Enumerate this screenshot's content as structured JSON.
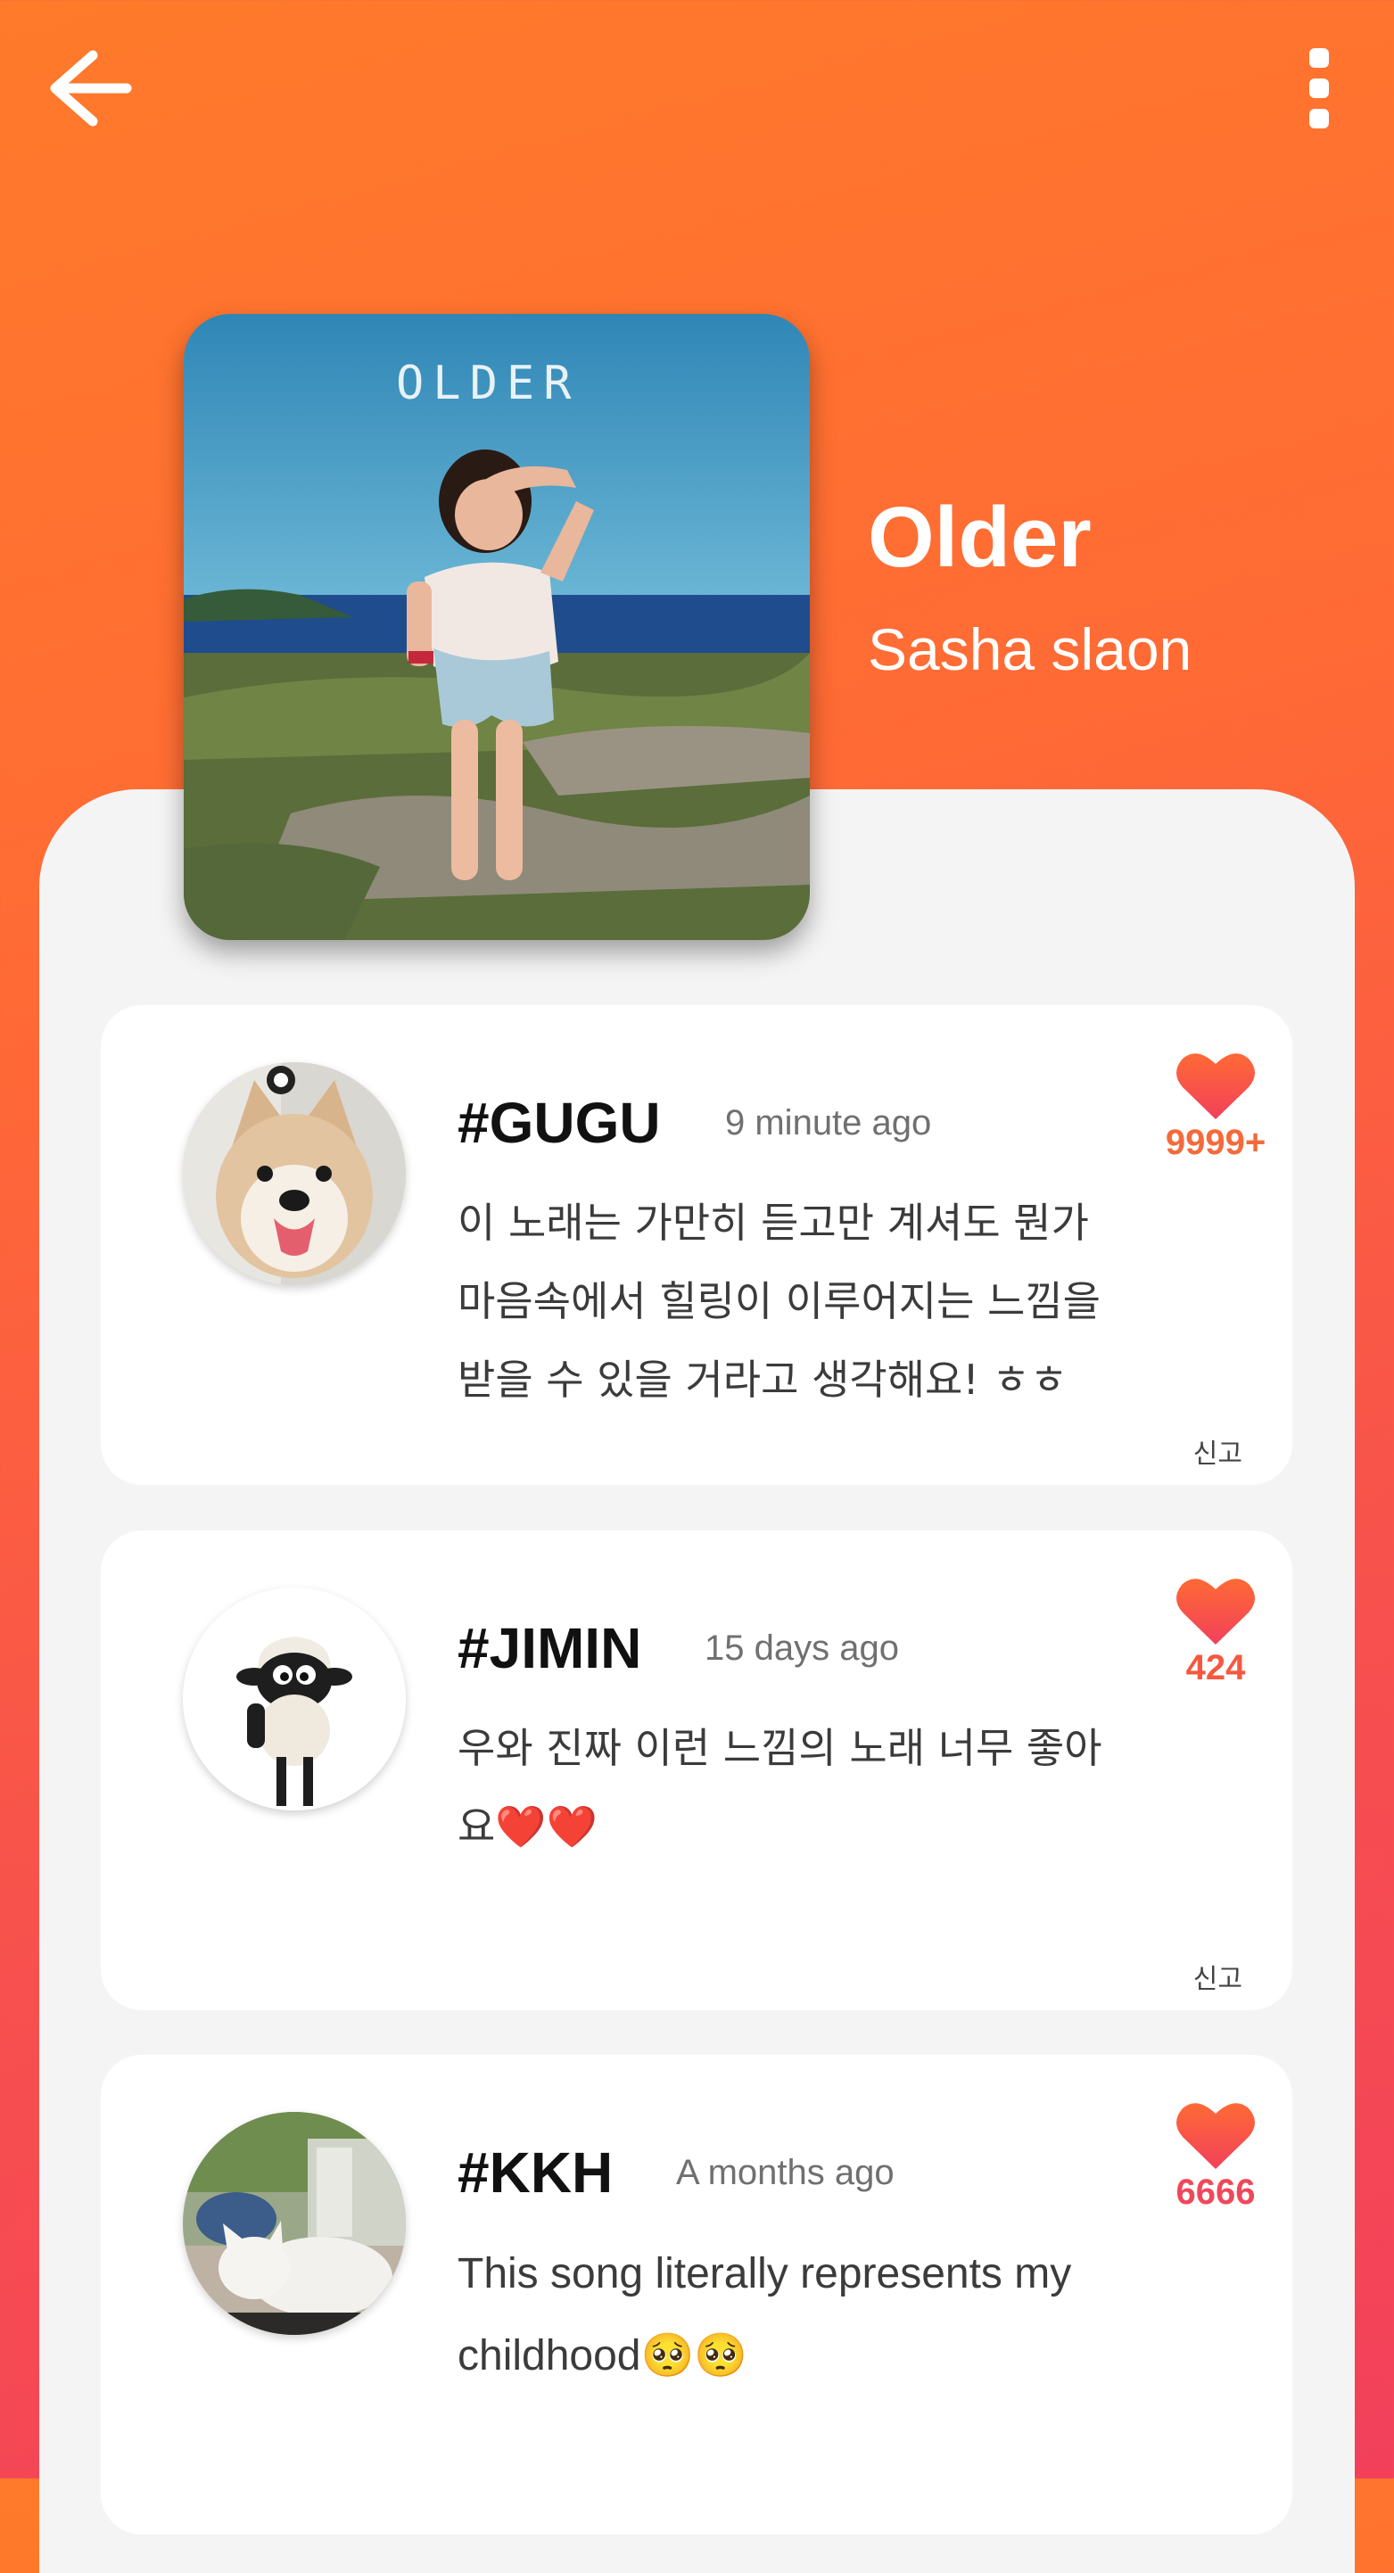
{
  "header": {
    "back_icon": "arrow-left-icon",
    "menu_icon": "more-vertical-icon"
  },
  "song": {
    "cover_text": "OLDER",
    "title": "Older",
    "artist": "Sasha slaon"
  },
  "comments": [
    {
      "username": "#GUGU",
      "time": "9 minute ago",
      "text": "이 노래는 가만히 듣고만 계셔도 뭔가 마음속에서 힐링이 이루어지는 느낌을 받을 수 있을 거라고 생각해요! ㅎㅎ",
      "likes": "9999+",
      "like_color": "#f46a3a",
      "report_label": "신고",
      "avatar": "dog"
    },
    {
      "username": "#JIMIN",
      "time": "15 days ago",
      "text": "우와 진짜 이런 느낌의 노래 너무 좋아요❤️❤️",
      "likes": "424",
      "like_color": "#f4593f",
      "report_label": "신고",
      "avatar": "sheep"
    },
    {
      "username": "#KKH",
      "time": "A months ago",
      "text": "This song literally represents my childhood🥺🥺",
      "likes": "6666",
      "like_color": "#f0485a",
      "report_label": "",
      "avatar": "cat"
    }
  ],
  "colors": {
    "gradient_top": "#ff7a2a",
    "gradient_bottom": "#f2405b",
    "heart_top": "#ff6a35",
    "heart_bottom": "#f2405b"
  }
}
